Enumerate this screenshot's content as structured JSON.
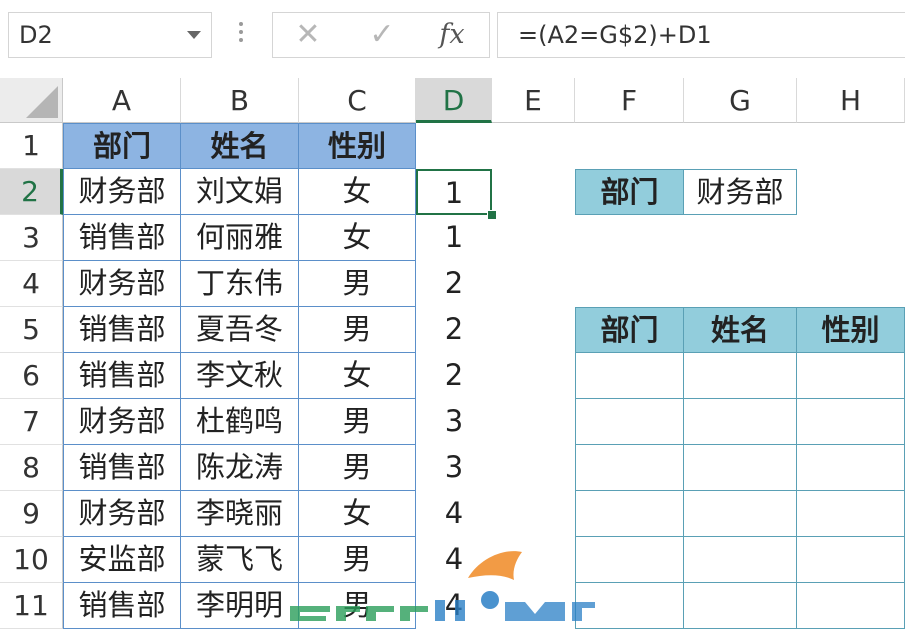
{
  "formula_bar": {
    "name_box": "D2",
    "cancel_label": "✕",
    "enter_label": "✓",
    "fx_label": "fx",
    "formula": "=(A2=G$2)+D1"
  },
  "columns": [
    "A",
    "B",
    "C",
    "D",
    "E",
    "F",
    "G",
    "H"
  ],
  "active_column": "D",
  "active_row": "2",
  "rows": [
    "1",
    "2",
    "3",
    "4",
    "5",
    "6",
    "7",
    "8",
    "9",
    "10",
    "11"
  ],
  "source_table": {
    "headers": [
      "部门",
      "姓名",
      "性别"
    ],
    "rows": [
      [
        "财务部",
        "刘文娟",
        "女"
      ],
      [
        "销售部",
        "何丽雅",
        "女"
      ],
      [
        "财务部",
        "丁东伟",
        "男"
      ],
      [
        "销售部",
        "夏吾冬",
        "男"
      ],
      [
        "销售部",
        "李文秋",
        "女"
      ],
      [
        "财务部",
        "杜鹤鸣",
        "男"
      ],
      [
        "销售部",
        "陈龙涛",
        "男"
      ],
      [
        "财务部",
        "李晓丽",
        "女"
      ],
      [
        "安监部",
        "蒙飞飞",
        "男"
      ],
      [
        "销售部",
        "李明明",
        "男"
      ]
    ]
  },
  "helper_column": [
    "1",
    "1",
    "2",
    "2",
    "2",
    "3",
    "3",
    "4",
    "4",
    "4"
  ],
  "criteria": {
    "label": "部门",
    "value": "财务部"
  },
  "output_table": {
    "headers": [
      "部门",
      "姓名",
      "性别"
    ],
    "empty_rows": 6
  },
  "watermark_text": "FreeHOME",
  "colors": {
    "selection": "#217346",
    "source_header_fill": "#8db4e2",
    "output_header_fill": "#92cddc",
    "watermark_blue": "#2a7fc6",
    "watermark_orange": "#f08a24",
    "watermark_green": "#2a9d5a"
  }
}
